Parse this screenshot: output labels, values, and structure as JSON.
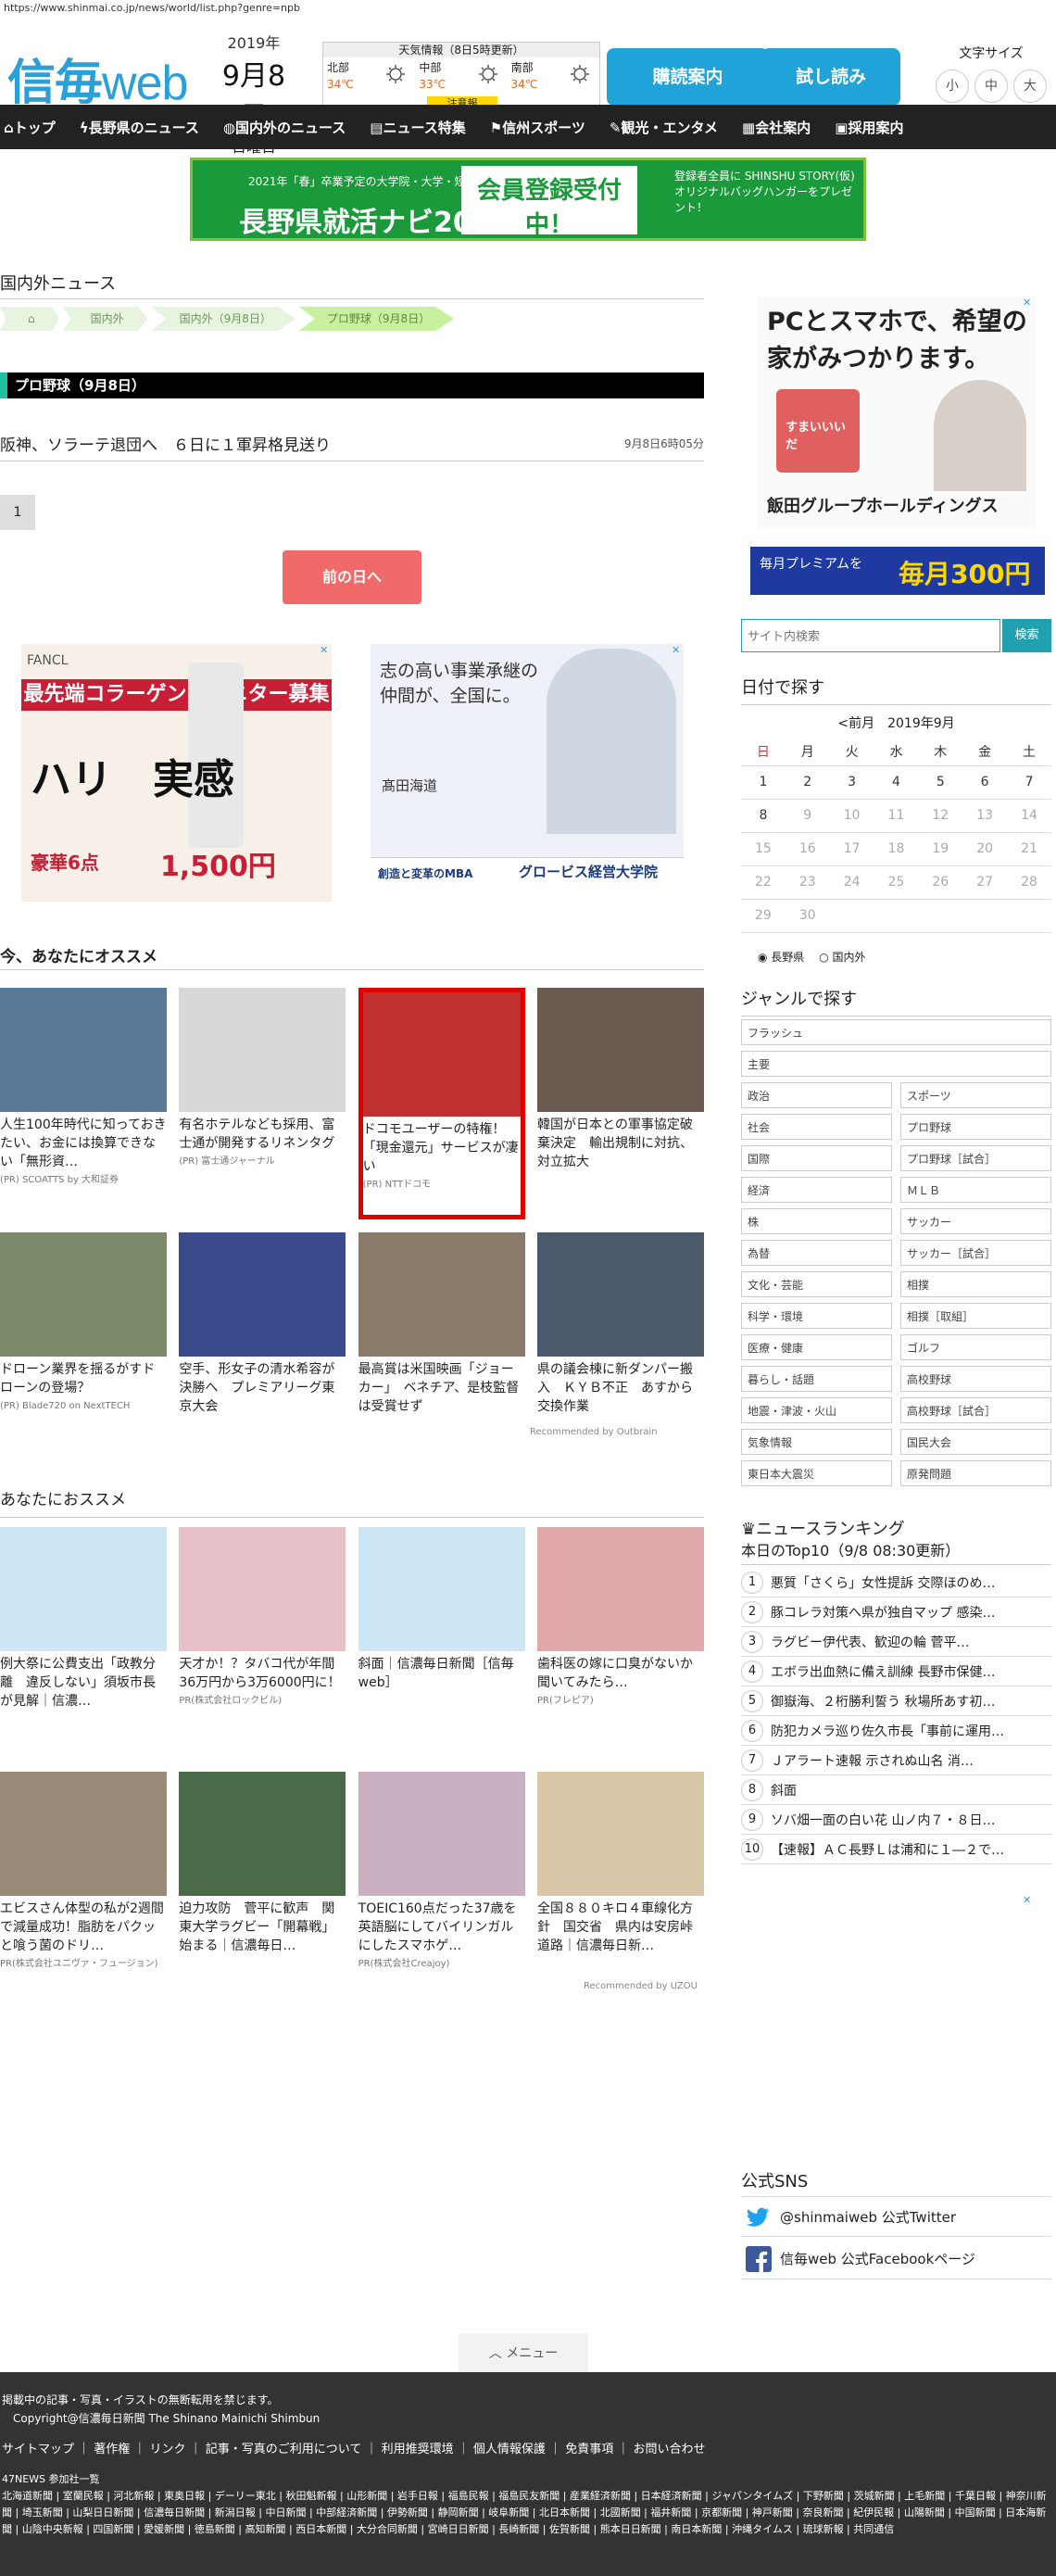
{
  "url": "https://www.shinmai.co.jp/news/world/list.php?genre=npb",
  "logo": {
    "a": "信毎",
    "b": "web"
  },
  "date": {
    "year": "2019年",
    "md": "9月8日",
    "dow": "日曜日"
  },
  "weather": {
    "title": "天気情報（8日5時更新）",
    "regions": [
      {
        "name": "北部",
        "temp": "34℃"
      },
      {
        "name": "中部",
        "temp": "33℃"
      },
      {
        "name": "南部",
        "temp": "34℃"
      }
    ],
    "warning": "注意報"
  },
  "buttons": {
    "subscribe": "購読案内",
    "trial": "試し読み"
  },
  "font_size": {
    "label": "文字サイズ",
    "small": "小",
    "medium": "中",
    "large": "大"
  },
  "nav": [
    "トップ",
    "長野県のニュース",
    "国内外のニュース",
    "ニュース特集",
    "信州スポーツ",
    "観光・エンタメ",
    "会社案内",
    "採用案内"
  ],
  "banner": {
    "l1": "2021年「春」卒業予定の大学院・大学・短大・高専・専門学校生のための",
    "l2": "長野県就活ナビ2021",
    "mid": "会員登録受付中！",
    "r": "登録者全員に SHINSHU STORY(仮)  オリジナルバッグハンガーをプレゼント！"
  },
  "section_title": "国内外ニュース",
  "breadcrumb": [
    "国内外",
    "国内外（9月8日）",
    "プロ野球（9月8日）"
  ],
  "category_bar": "プロ野球（9月8日）",
  "article": {
    "title": "阪神、ソラーテ退団へ　６日に１軍昇格見送り",
    "time": "9月8日6時05分"
  },
  "page": "1",
  "prev_day": "前の日へ",
  "ad1": {
    "brand": "FANCL",
    "head": "最先端コラーゲンのモニター募集",
    "big": "ハリ　実感",
    "price": "1,500円",
    "sub": "豪華6点"
  },
  "ad2": {
    "text": "志の高い事業承継の仲間が、全国に。",
    "name": "髙田海道",
    "slogan": "創造と変革のMBA",
    "uni": "グロービス経営大学院"
  },
  "recommend_title": "今、あなたにオススメ",
  "recommend": [
    {
      "text": "人生100年時代に知っておきたい、お金には換算できない「無形資…",
      "src": "(PR) SCOATTS by 大和証券",
      "color": "#5a7a9a"
    },
    {
      "text": "有名ホテルなども採用、富士通が開発するリネンタグ",
      "src": "(PR) 富士通ジャーナル",
      "color": "#d8d8d8"
    },
    {
      "text": "ドコモユーザーの特権！「現金還元」サービスが凄い",
      "src": "(PR) NTTドコモ",
      "color": "#c03030"
    },
    {
      "text": "韓国が日本との軍事協定破棄決定　輸出規制に対抗、対立拡大",
      "src": "",
      "color": "#6a5a50"
    },
    {
      "text": "ドローン業界を揺るがすドローンの登場？",
      "src": "(PR) Blade720 on NextTECH",
      "color": "#7a8a6a"
    },
    {
      "text": "空手、形女子の清水希容が決勝へ　プレミアリーグ東京大会",
      "src": "",
      "color": "#3a4a8a"
    },
    {
      "text": "最高賞は米国映画「ジョーカー」　ベネチア、是枝監督は受賞せず",
      "src": "",
      "color": "#8a7a6a"
    },
    {
      "text": "県の議会棟に新ダンパー搬入　ＫＹＢ不正　あすから交換作業",
      "src": "",
      "color": "#4a5a6a"
    }
  ],
  "outbrain": "Recommended by Outbrain",
  "recommend2_title": "あなたにおススメ",
  "recommend2": [
    {
      "text": "例大祭に公費支出「政教分離　違反しない」須坂市長が見解｜信濃…",
      "src": "",
      "color": "#cde6f4"
    },
    {
      "text": "天才か！？タバコ代が年間36万円から3万6000円に！",
      "src": "PR(株式会社ロックビル)",
      "color": "#e8c0c8"
    },
    {
      "text": "斜面｜信濃毎日新聞［信毎web］",
      "src": "",
      "color": "#cde6f4"
    },
    {
      "text": "歯科医の嫁に口臭がないか聞いてみたら…",
      "src": "PR(フレピア)",
      "color": "#e0a8a8"
    },
    {
      "text": "エビスさん体型の私が2週間で減量成功！脂肪をパクッと喰う菌のドリ…",
      "src": "PR(株式会社ユニヴァ・フュージョン)",
      "color": "#9a8a7a"
    },
    {
      "text": "迫力攻防　菅平に歓声　関東大学ラグビー「開幕戦」始まる｜信濃毎日…",
      "src": "",
      "color": "#4a6a4a"
    },
    {
      "text": "TOEIC160点だった37歳を英語脳にしてバイリンガルにしたスマホゲ…",
      "src": "PR(株式会社Creajoy)",
      "color": "#c8b0c0"
    },
    {
      "text": "全国８８０キロ４車線化方針　国交省　県内は安房峠道路｜信濃毎日新…",
      "src": "",
      "color": "#d8c8a8"
    }
  ],
  "uzou": "Recommended by UZOU",
  "menu": "メニュー",
  "side_ad": {
    "title": "PCとスマホで、希望の家がみつかります。",
    "house_label": "すまいいいだ",
    "company": "飯田グループホールディングス",
    "ad2a": "毎月プレミアムを",
    "ad2b": "毎月300円"
  },
  "search": {
    "placeholder": "サイト内検索",
    "button": "検索"
  },
  "date_search": {
    "title": "日付で探す",
    "prev": "<前月",
    "month": "2019年9月"
  },
  "calendar": {
    "weekdays": [
      "日",
      "月",
      "火",
      "水",
      "木",
      "金",
      "土"
    ],
    "days": [
      "1",
      "2",
      "3",
      "4",
      "5",
      "6",
      "7",
      "8",
      "9",
      "10",
      "11",
      "12",
      "13",
      "14",
      "15",
      "16",
      "17",
      "18",
      "19",
      "20",
      "21",
      "22",
      "23",
      "24",
      "25",
      "26",
      "27",
      "28",
      "29",
      "30"
    ],
    "active_upto": 8
  },
  "radios": [
    "長野県",
    "国内外"
  ],
  "genre": {
    "title": "ジャンルで探す",
    "full": [
      "フラッシュ",
      "主要"
    ],
    "pairs": [
      [
        "政治",
        "スポーツ"
      ],
      [
        "社会",
        "プロ野球"
      ],
      [
        "国際",
        "プロ野球［試合］"
      ],
      [
        "経済",
        "ＭＬＢ"
      ],
      [
        "株",
        "サッカー"
      ],
      [
        "為替",
        "サッカー［試合］"
      ],
      [
        "文化・芸能",
        "相撲"
      ],
      [
        "科学・環境",
        "相撲［取組］"
      ],
      [
        "医療・健康",
        "ゴルフ"
      ],
      [
        "暮らし・話題",
        "高校野球"
      ],
      [
        "地震・津波・火山",
        "高校野球［試合］"
      ],
      [
        "気象情報",
        "国民大会"
      ],
      [
        "東日本大震災",
        "原発問題"
      ]
    ]
  },
  "ranking": {
    "title": "ニュースランキング",
    "sub": "本日のTop10（9/8 08:30更新）",
    "items": [
      "悪質「さくら」女性提訴 交際ほのめ…",
      "豚コレラ対策へ県が独自マップ 感染…",
      "ラグビー伊代表、歓迎の輪 菅平…",
      "エボラ出血熱に備え訓練 長野市保健…",
      "御嶽海、２桁勝利誓う 秋場所あす初…",
      "防犯カメラ巡り佐久市長「事前に運用…",
      "Ｊアラート速報 示されぬ山名 消…",
      "斜面",
      "ソバ畑一面の白い花 山ノ内７・８日…",
      "【速報】ＡＣ長野Ｌは浦和に１―２で…"
    ]
  },
  "sns": {
    "title": "公式SNS",
    "twitter": "@shinmaiweb 公式Twitter",
    "facebook": "信毎web 公式Facebookページ"
  },
  "footer": {
    "copy1": "掲載中の記事・写真・イラストの無断転用を禁じます。",
    "copy2": "Copyright@信濃毎日新聞 The Shinano Mainichi Shimbun",
    "links": "サイトマップ ｜ 著作権 ｜ リンク ｜ 記事・写真のご利用について ｜ 利用推奨環境 ｜ 個人情報保護 ｜ 免責事項 ｜ お問い合わせ",
    "ntw_title": "47NEWS 参加社一覧",
    "ntw": "北海道新聞 | 室蘭民報 | 河北新報 | 東奥日報 | デーリー東北 | 秋田魁新報 | 山形新聞 | 岩手日報 | 福島民報 | 福島民友新聞 | 産業経済新聞 | 日本経済新聞 | ジャパンタイムズ | 下野新聞 | 茨城新聞 | 上毛新聞 | 千葉日報 | 神奈川新聞 | 埼玉新聞 | 山梨日日新聞 | 信濃毎日新聞 | 新潟日報 | 中日新聞 | 中部経済新聞 | 伊勢新聞 | 静岡新聞 | 岐阜新聞 | 北日本新聞 | 北國新聞 | 福井新聞 | 京都新聞 | 神戸新聞 | 奈良新聞 | 紀伊民報 | 山陽新聞 | 中国新聞 | 日本海新聞 | 山陰中央新報 | 四国新聞 | 愛媛新聞 | 徳島新聞 | 高知新聞 | 西日本新聞 | 大分合同新聞 | 宮崎日日新聞 | 長崎新聞 | 佐賀新聞 | 熊本日日新聞 | 南日本新聞 | 沖縄タイムス | 琉球新報 | 共同通信"
  },
  "colors": {
    "brand": "#2a9fd8",
    "nav": "#222222",
    "accent": "#20a0b0",
    "prev": "#f06a6a",
    "highlight": "#e00000"
  }
}
